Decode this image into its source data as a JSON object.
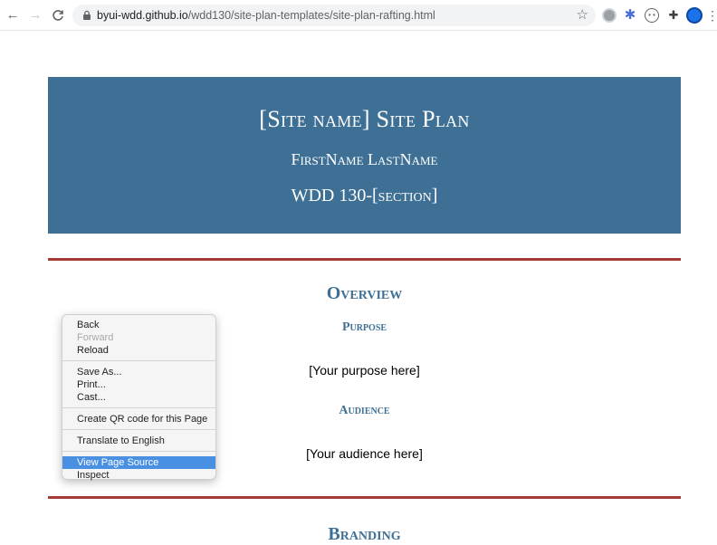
{
  "browser": {
    "back_glyph": "←",
    "forward_glyph": "→",
    "reload_glyph": "C",
    "url_host": "byui-wdd.github.io",
    "url_path": "/wdd130/site-plan-templates/site-plan-rafting.html",
    "star_glyph": "☆",
    "icons": [
      "back-arrow-icon",
      "forward-arrow-icon",
      "reload-icon",
      "lock-icon",
      "star-icon",
      "extension-icons",
      "puzzle-icon",
      "profile-icon",
      "menu-dots-icon"
    ]
  },
  "hero": {
    "title": "[Site name] Site Plan",
    "name": "FirstName LastName",
    "course": "WDD 130-[section]"
  },
  "overview": {
    "heading": "Overview",
    "purpose_heading": "Purpose",
    "purpose_text": "[Your purpose here]",
    "audience_heading": "Audience",
    "audience_text": "[Your audience here]"
  },
  "branding": {
    "heading": "Branding"
  },
  "context_menu": {
    "back": "Back",
    "forward": "Forward",
    "reload": "Reload",
    "save_as": "Save As...",
    "print": "Print...",
    "cast": "Cast...",
    "qr": "Create QR code for this Page",
    "translate": "Translate to English",
    "view_source": "View Page Source",
    "inspect": "Inspect"
  },
  "colors": {
    "hero_bg": "#3e7096",
    "divider": "#a33a35",
    "heading": "#3e7096",
    "menu_highlight": "#4a90e2"
  }
}
